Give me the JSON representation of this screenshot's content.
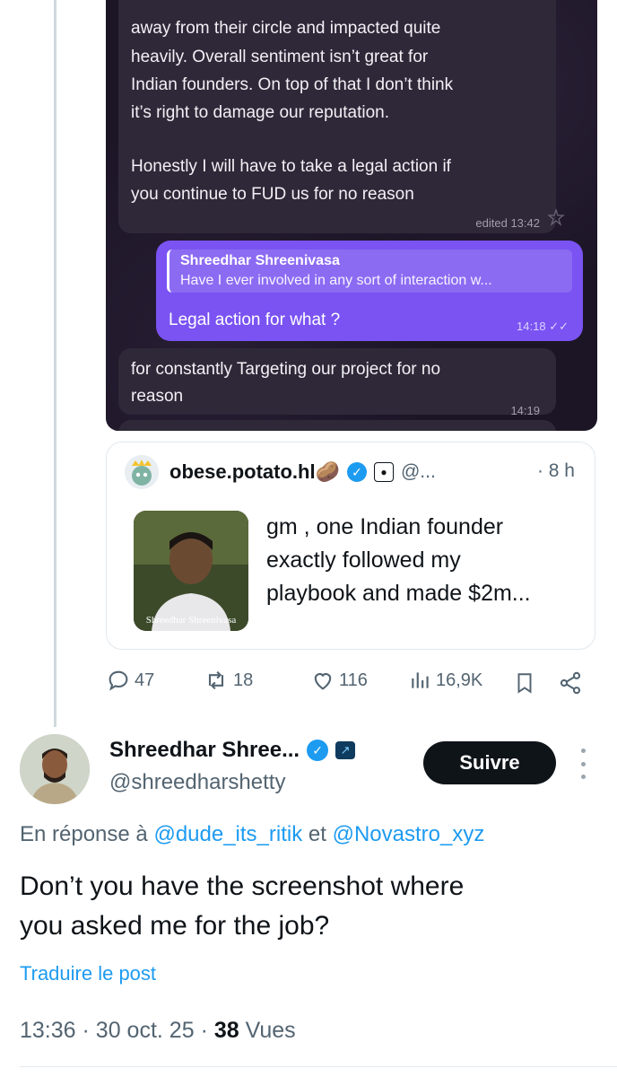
{
  "chat": {
    "msg1_lines": [
      "away from their circle and impacted quite",
      "heavily. Overall sentiment isn’t great for",
      "Indian founders. On top of that I don’t think",
      "it’s right to damage our reputation.",
      "",
      "Honestly I will have to take a legal action if",
      "you continue to FUD us for no reason"
    ],
    "msg1_time": "edited 13:42",
    "reply_quote_name": "Shreedhar Shreenivasa",
    "reply_quote_text": "Have I ever involved in any sort of interaction w...",
    "reply_text": "Legal action for what ?",
    "reply_time": "14:18",
    "msg3_lines": [
      "for constantly Targeting our project for no",
      "reason"
    ],
    "msg3_time": "14:19"
  },
  "quoted": {
    "name": "obese.potato.hl🥔",
    "handle": "@...",
    "time": "· 8 h",
    "text_lines": [
      "gm , one Indian founder",
      "exactly followed my",
      "playbook and made $2m..."
    ],
    "thumb_caption": "Shreedhar Shreenivasa"
  },
  "actions": {
    "replies": "47",
    "reposts": "18",
    "likes": "116",
    "views": "16,9K"
  },
  "post": {
    "name": "Shreedhar Shree...",
    "handle": "@shreedharshetty",
    "follow_label": "Suivre",
    "reply_prefix": "En réponse à",
    "reply_user1": "@dude_its_ritik",
    "reply_and": "et",
    "reply_user2": "@Novastro_xyz",
    "text_line1": "Don’t you have the screenshot where",
    "text_line2": "you asked me for the job?",
    "translate": "Traduire le post",
    "time": "13:36",
    "date": "30 oct. 25",
    "views_count": "38",
    "views_label": "Vues"
  },
  "colors": {
    "accent": "#1d9bf0",
    "chat_bg": "#1c1526",
    "bubble_out": "#7a53f2",
    "bubble_in": "#2e2838"
  }
}
